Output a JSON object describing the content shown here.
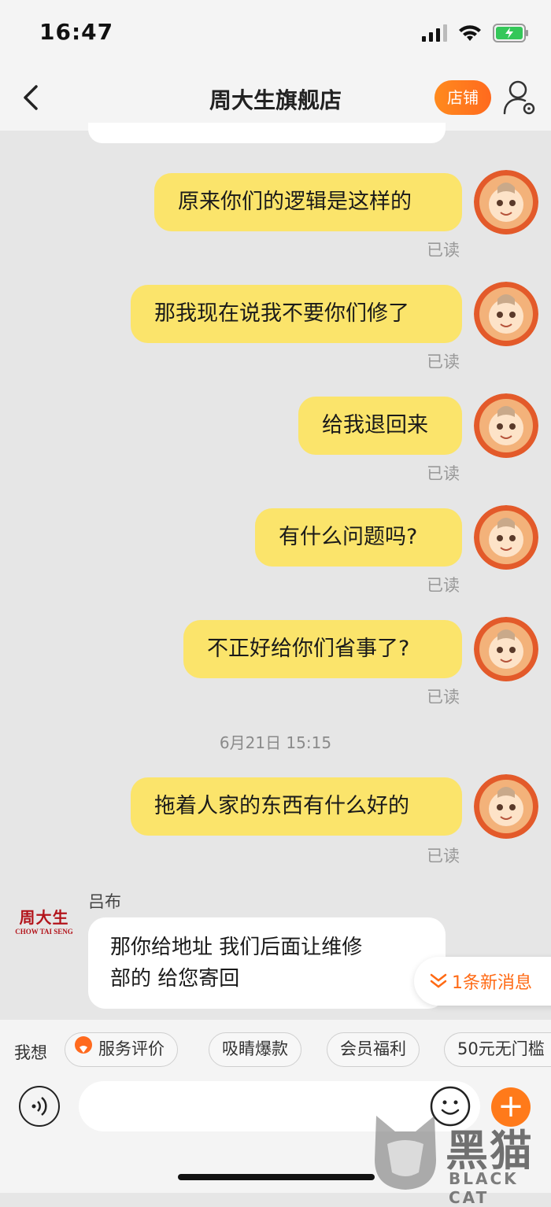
{
  "status_bar": {
    "time": "16:47"
  },
  "header": {
    "title": "周大生旗舰店",
    "shop_button": "店铺"
  },
  "messages": [
    {
      "text": "原来你们的逻辑是这样的",
      "status": "已读"
    },
    {
      "text": "那我现在说我不要你们修了",
      "status": "已读"
    },
    {
      "text": "给我退回来",
      "status": "已读"
    },
    {
      "text": "有什么问题吗?",
      "status": "已读"
    },
    {
      "text": "不正好给你们省事了?",
      "status": "已读"
    },
    {
      "text": "拖着人家的东西有什么好的",
      "status": "已读"
    }
  ],
  "timestamp": "6月21日 15:15",
  "reply": {
    "sender": "吕布",
    "logo_text": "周大生",
    "logo_sub": "CHOW TAI SENG",
    "line1": "那你给地址 我们后面让维修",
    "line2": "部的 给您寄回"
  },
  "new_message_badge": "1条新消息",
  "quick_bar": {
    "label": "我想",
    "chips": [
      "服务评价",
      "吸睛爆款",
      "会员福利",
      "50元无门槛"
    ]
  },
  "watermark": {
    "cn": "黑猫",
    "en": "BLACK CAT"
  },
  "colors": {
    "accent": "#ff6a1e",
    "bubble": "#fbe46b",
    "background": "#e6e6e6"
  }
}
